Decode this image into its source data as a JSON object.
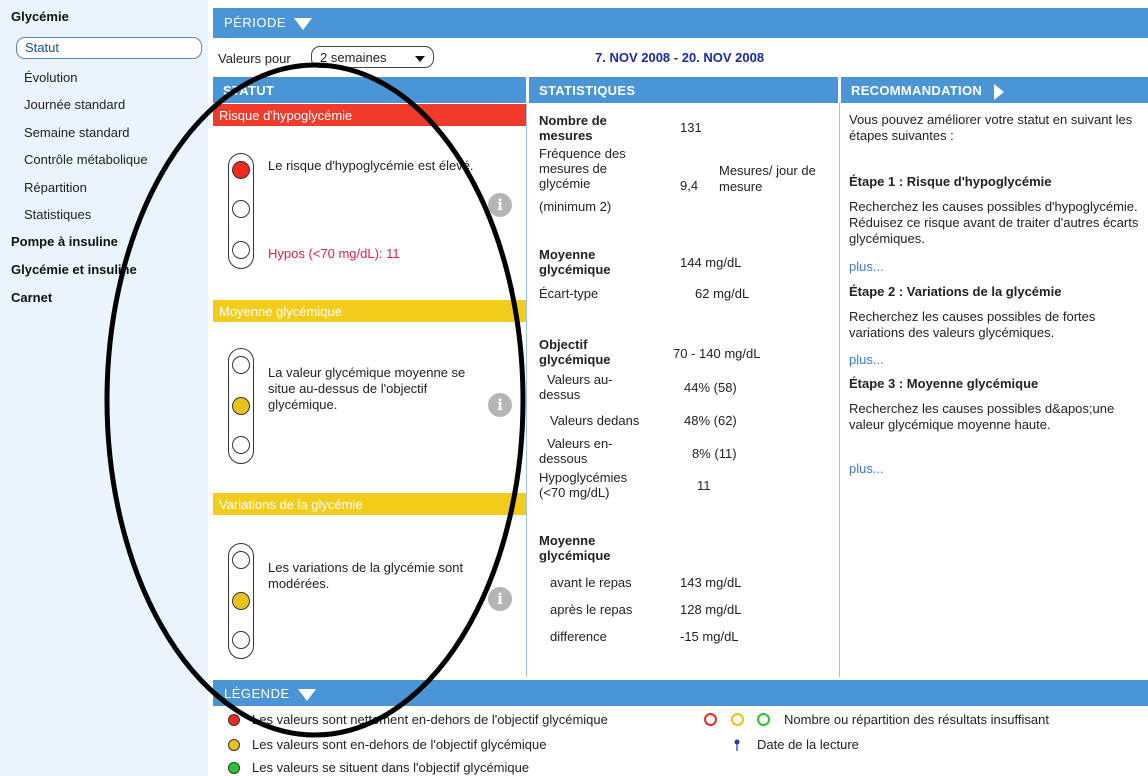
{
  "sidebar": {
    "sections": [
      "Glycémie",
      "Pompe à insuline",
      "Glycémie et insuline",
      "Carnet"
    ],
    "items": [
      "Statut",
      "Évolution",
      "Journée standard",
      "Semaine standard",
      "Contrôle métabolique",
      "Répartition",
      "Statistiques"
    ]
  },
  "period": {
    "title": "PÉRIODE",
    "values_label": "Valeurs pour",
    "select_value": "2 semaines",
    "date_range": "7. NOV 2008 - 20. NOV 2008"
  },
  "columns": {
    "status": "STATUT",
    "stats": "STATISTIQUES",
    "recommendation": "RECOMMANDATION"
  },
  "status": {
    "hypo": {
      "title": "Risque d'hypoglycémie",
      "text": "Le risque d'hypoglycémie est élevé.",
      "hypos": "Hypos (<70 mg/dL):  11"
    },
    "mean": {
      "title": "Moyenne glycémique",
      "text": "La valeur glycémique moyenne se situe au-dessus de l'objectif glycémique."
    },
    "variation": {
      "title": "Variations de la glycémie",
      "text": "Les variations de la glycémie sont modérées."
    },
    "info_glyph": "i"
  },
  "stats": {
    "nb_label": "Nombre de mesures",
    "nb_value": "131",
    "freq_label": "Fréquence des mesures de glycémie",
    "freq_min": "(minimum 2)",
    "freq_value": "9,4",
    "freq_unit": "Mesures/ jour de mesure",
    "mean_label": "Moyenne glycémique",
    "mean_value": "144  mg/dL",
    "sd_label": "Écart-type",
    "sd_value": "62  mg/dL",
    "target_label": "Objectif glycémique",
    "target_value": "70 - 140  mg/dL",
    "above_label": "Valeurs au-dessus",
    "above_value": "44%  (58)",
    "within_label": "Valeurs dedans",
    "within_value": "48%  (62)",
    "below_label": "Valeurs en-dessous",
    "below_value": "8%  (11)",
    "hypo_label": "Hypoglycémies (<70 mg/dL)",
    "hypo_value": "11",
    "mean2_label": "Moyenne glycémique",
    "before_label": "avant le repas",
    "before_value": "143  mg/dL",
    "after_label": "après le repas",
    "after_value": "128  mg/dL",
    "diff_label": "difference",
    "diff_value": "-15  mg/dL"
  },
  "recommendation": {
    "intro": "Vous pouvez améliorer votre statut en suivant les étapes suivantes :",
    "step1_title": "Étape 1 : Risque d'hypoglycémie",
    "step1_text": "Recherchez les causes possibles d'hypoglycémie. Réduisez ce risque avant de traiter d'autres écarts glycémiques.",
    "step2_title": "Étape 2 : Variations de la glycémie",
    "step2_text": "Recherchez les causes possibles de fortes variations des valeurs glycémiques.",
    "step3_title": "Étape 3 : Moyenne glycémique",
    "step3_text": "Recherchez les causes possibles d&apos;une valeur glycémique moyenne haute.",
    "more": "plus..."
  },
  "legend": {
    "title": "LÉGENDE",
    "red": "Les valeurs sont nettement en-dehors de l'objectif glycémique",
    "yellow": "Les valeurs sont en-dehors de l'objectif glycémique",
    "green": "Les valeurs se situent dans l'objectif glycémique",
    "insufficient": "Nombre ou répartition des résultats insuffisant",
    "reading_date": "Date de la lecture"
  },
  "colors": {
    "header_blue": "#4a95d6",
    "red": "#ee2a1f",
    "yellow": "#e6c21b",
    "green": "#2ec42e"
  }
}
